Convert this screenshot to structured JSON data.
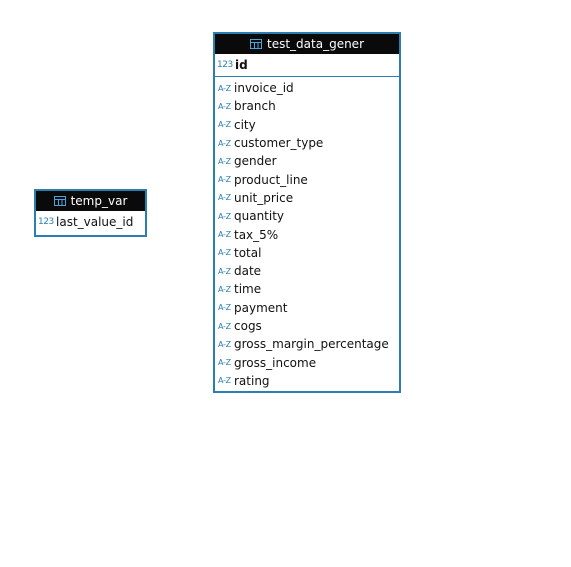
{
  "entities": {
    "test_data_gener": {
      "title": "test_data_gener",
      "pk": {
        "type": "123",
        "name": "id"
      },
      "columns": [
        {
          "type": "A-Z",
          "name": "invoice_id"
        },
        {
          "type": "A-Z",
          "name": "branch"
        },
        {
          "type": "A-Z",
          "name": "city"
        },
        {
          "type": "A-Z",
          "name": "customer_type"
        },
        {
          "type": "A-Z",
          "name": "gender"
        },
        {
          "type": "A-Z",
          "name": "product_line"
        },
        {
          "type": "A-Z",
          "name": "unit_price"
        },
        {
          "type": "A-Z",
          "name": "quantity"
        },
        {
          "type": "A-Z",
          "name": "tax_5%"
        },
        {
          "type": "A-Z",
          "name": "total"
        },
        {
          "type": "A-Z",
          "name": "date"
        },
        {
          "type": "A-Z",
          "name": "time"
        },
        {
          "type": "A-Z",
          "name": "payment"
        },
        {
          "type": "A-Z",
          "name": "cogs"
        },
        {
          "type": "A-Z",
          "name": "gross_margin_percentage"
        },
        {
          "type": "A-Z",
          "name": "gross_income"
        },
        {
          "type": "A-Z",
          "name": "rating"
        }
      ]
    },
    "temp_var": {
      "title": "temp_var",
      "pk": {
        "type": "123",
        "name": "last_value_id"
      }
    }
  }
}
